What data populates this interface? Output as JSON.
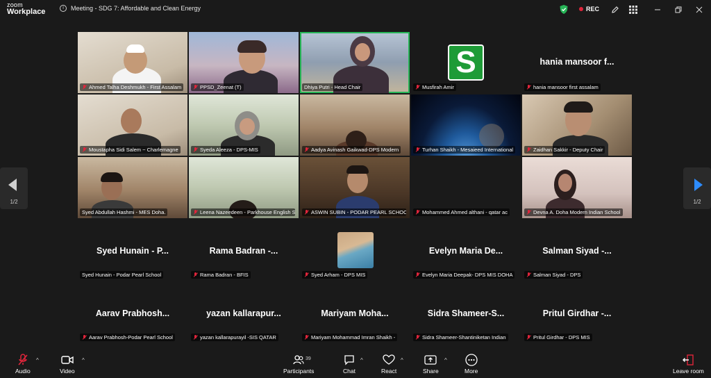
{
  "app": {
    "logo_top": "zoom",
    "logo_bottom": "Workplace"
  },
  "meeting": {
    "title": "Meeting - SDG 7: Affordable and Clean Energy",
    "rec_label": "REC"
  },
  "colors": {
    "rec": "#e0253b",
    "active_speaker": "#27b557",
    "avatar_bg": "#1e9b37",
    "next_arrow": "#2d8cff"
  },
  "pager": {
    "left": "1/2",
    "right": "1/2"
  },
  "tiles": [
    {
      "name": "Ahmed Talha Deshmukh - First Assalam"
    },
    {
      "name": "PPSD_Zeenat (T)"
    },
    {
      "name": "Dhiya Putri - Head Chair"
    },
    {
      "name": "Musfirah Amir",
      "avatar_letter": "S"
    },
    {
      "name": "hania mansoor first assalam",
      "display_name": "hania mansoor f..."
    },
    {
      "name": "Moustapha Sidi Salem ~ Charlemagne"
    },
    {
      "name": "Syeda Aleeza - DPS-MIS"
    },
    {
      "name": "Aadya Avinash Gaikwad-DPS Modern"
    },
    {
      "name": "Turhan Shaikh - Mesaieed International"
    },
    {
      "name": "Zaidhan Sakkir - Deputy Chair"
    },
    {
      "name": "Syed Abdullah Hashmi - MES Doha."
    },
    {
      "name": "Leena Nazeedeen - Parkhouse English School"
    },
    {
      "name": "ASWIN SUBIN - PODAR PEARL SCHOOL"
    },
    {
      "name": "Mohammed Ahmed althani - qatar ac"
    },
    {
      "name": "Devna A.  Doha Modern Indian School"
    },
    {
      "name": "Syed Hunain - Podar Pearl School",
      "display_name": "Syed Hunain - P..."
    },
    {
      "name": "Rama Badran - BFIS",
      "display_name": "Rama Badran -..."
    },
    {
      "name": "Syed Arham - DPS MIS"
    },
    {
      "name": "Evelyn Maria Deepak- DPS MIS DOHA",
      "display_name": "Evelyn Maria De..."
    },
    {
      "name": "Salman Siyad - DPS",
      "display_name": "Salman Siyad -..."
    },
    {
      "name": "Aarav Prabhosh-Podar Pearl School",
      "display_name": "Aarav Prabhosh..."
    },
    {
      "name": "yazan kallarapurayil -SIS QATAR",
      "display_name": "yazan kallarapur..."
    },
    {
      "name": "Mariyam Mohammad Imran Shaikh - ",
      "display_name": "Mariyam Moha..."
    },
    {
      "name": "Sidra Shameer-Shantiniketan Indian",
      "display_name": "Sidra Shameer-S..."
    },
    {
      "name": "Pritul Girdhar - DPS MIS",
      "display_name": "Pritul Girdhar -..."
    }
  ],
  "toolbar": {
    "audio": "Audio",
    "video": "Video",
    "participants": "Participants",
    "participants_count": "39",
    "chat": "Chat",
    "react": "React",
    "share": "Share",
    "more": "More",
    "leave": "Leave room"
  }
}
